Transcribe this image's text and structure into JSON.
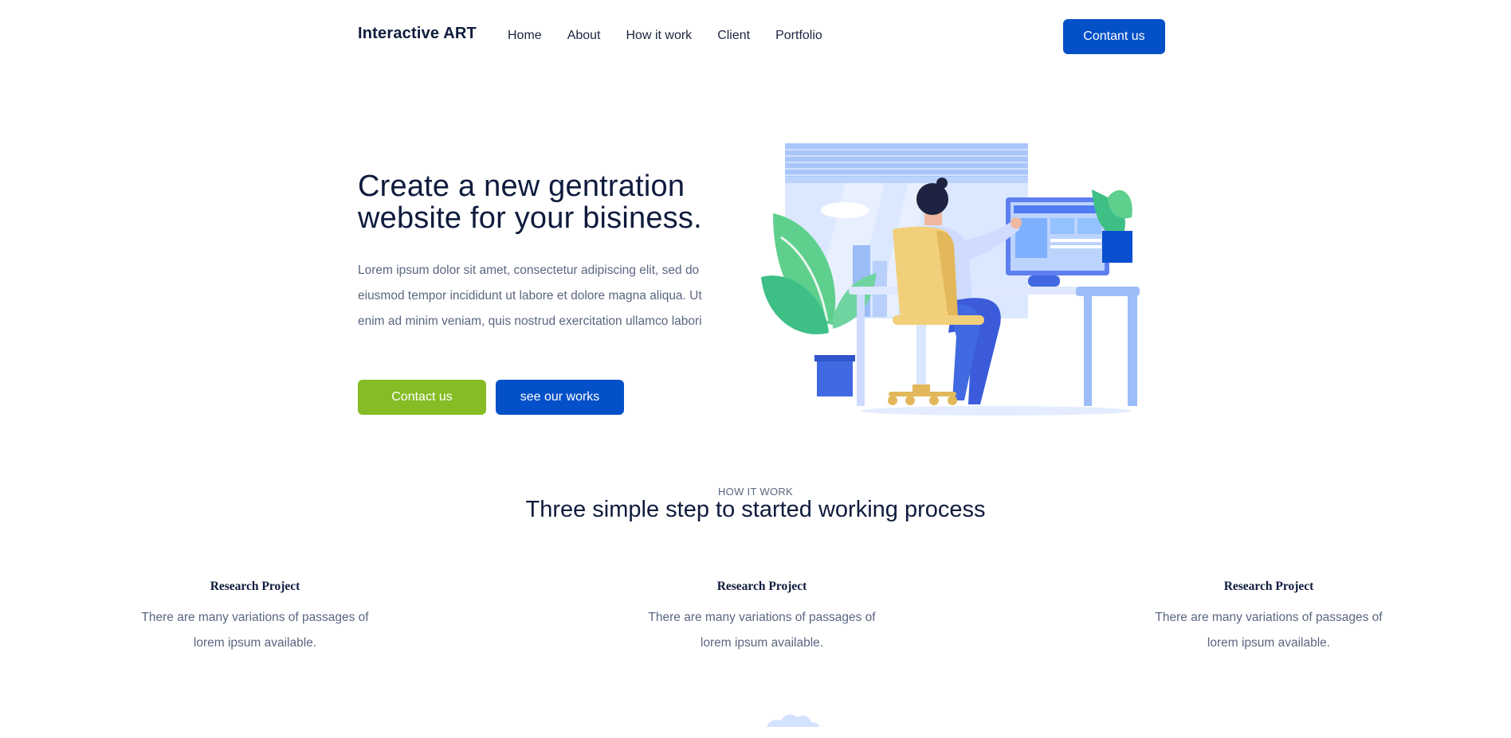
{
  "header": {
    "brand": "Interactive ART",
    "nav": [
      "Home",
      "About",
      "How it work",
      "Client",
      "Portfolio"
    ],
    "cta": "Contant us"
  },
  "hero": {
    "title": "Create a new gentration website for your bisiness.",
    "text": "Lorem ipsum dolor sit amet, consectetur adipiscing elit, sed do eiusmod tempor incididunt ut labore et dolore magna aliqua. Ut enim ad minim veniam, quis nostrud exercitation ullamco labori",
    "primary_button": "Contact us",
    "secondary_button": "see our works"
  },
  "how_it_work": {
    "kicker": "HOW IT WORK",
    "title": "Three simple step to started working process",
    "steps": [
      {
        "title": "Research Project",
        "text": "There are many variations of passages of lorem ipsum available."
      },
      {
        "title": "Research Project",
        "text": "There are many variations of passages of lorem ipsum available."
      },
      {
        "title": "Research Project",
        "text": "There are many variations of passages of lorem ipsum available."
      }
    ]
  },
  "colors": {
    "primary_blue": "#0450c8",
    "accent_green": "#86bc25",
    "heading": "#0f1b3d",
    "body_text": "#5a6680"
  },
  "icons": {
    "illustration": "person-working-at-desk-illustration"
  }
}
